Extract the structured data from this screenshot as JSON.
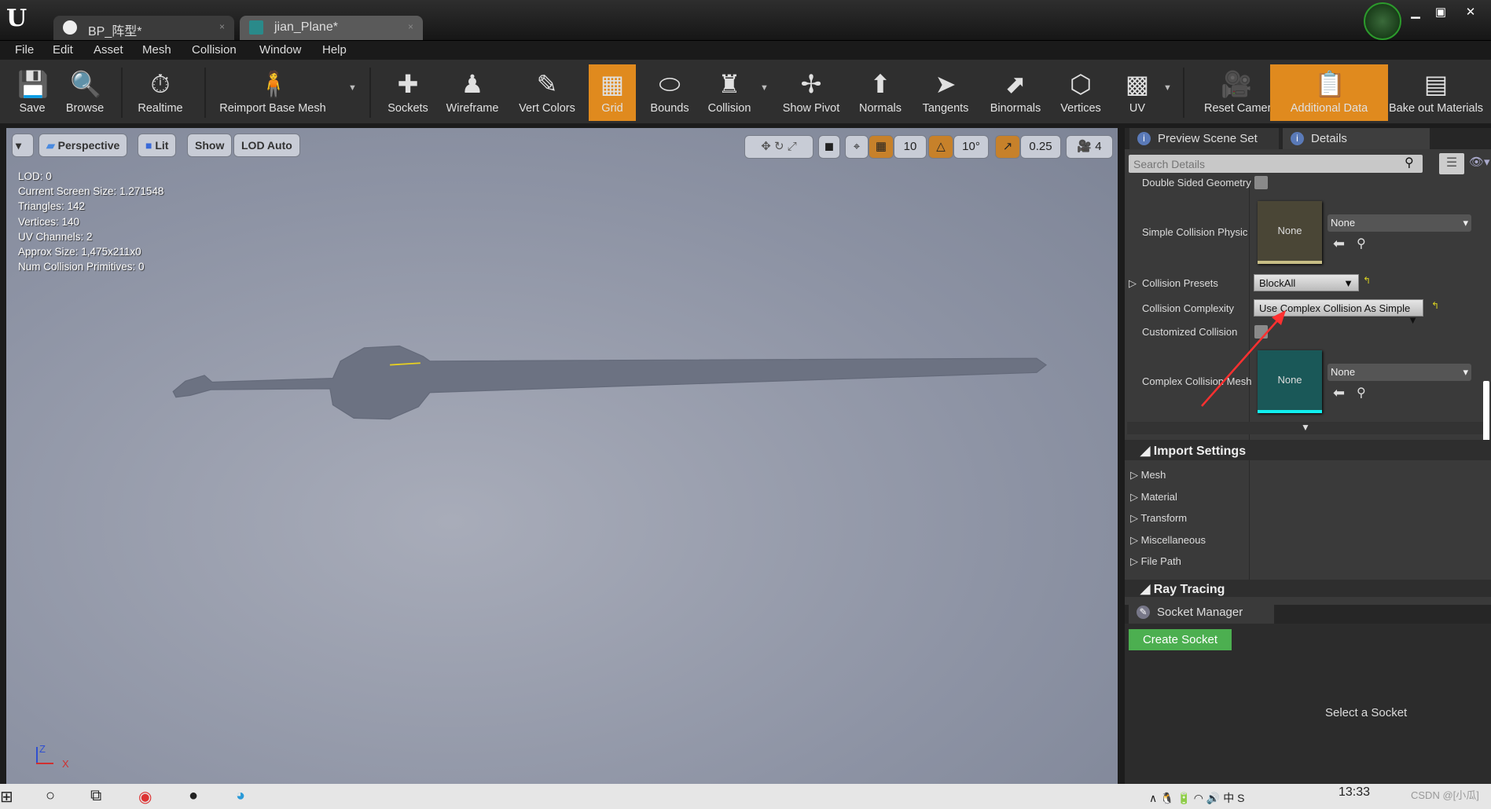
{
  "window": {
    "tabs": [
      {
        "label": "BP_阵型*"
      },
      {
        "label": "jian_Plane*"
      }
    ],
    "controls": [
      "minimize",
      "maximize",
      "close"
    ]
  },
  "menu": [
    "File",
    "Edit",
    "Asset",
    "Mesh",
    "Collision",
    "Window",
    "Help"
  ],
  "toolbar": [
    {
      "label": "Save",
      "icon": "💾"
    },
    {
      "label": "Browse",
      "icon": "🔍"
    },
    {
      "label": "Realtime",
      "icon": "⏱"
    },
    {
      "label": "Reimport Base Mesh",
      "icon": "🧍"
    },
    {
      "label": "Sockets",
      "icon": "✚"
    },
    {
      "label": "Wireframe",
      "icon": "♟"
    },
    {
      "label": "Vert Colors",
      "icon": "✎"
    },
    {
      "label": "Grid",
      "icon": "▦",
      "active": true
    },
    {
      "label": "Bounds",
      "icon": "⬭"
    },
    {
      "label": "Collision",
      "icon": "♜"
    },
    {
      "label": "Show Pivot",
      "icon": "✢"
    },
    {
      "label": "Normals",
      "icon": "⬆"
    },
    {
      "label": "Tangents",
      "icon": "➤"
    },
    {
      "label": "Binormals",
      "icon": "⬈"
    },
    {
      "label": "Vertices",
      "icon": "⬡"
    },
    {
      "label": "UV",
      "icon": "▩"
    },
    {
      "label": "Reset Camera",
      "icon": "🎥"
    },
    {
      "label": "Additional Data",
      "icon": "📋",
      "active": true
    },
    {
      "label": "Bake out Materials",
      "icon": "▤"
    }
  ],
  "viewport": {
    "buttons": {
      "perspective": "Perspective",
      "lit": "Lit",
      "show": "Show",
      "lod": "LOD Auto"
    },
    "stats": [
      "LOD:  0",
      "Current Screen Size:  1.271548",
      "Triangles:  142",
      "Vertices:  140",
      "UV Channels:  2",
      "Approx Size: 1,475x211x0",
      "Num Collision Primitives:  0"
    ],
    "grid_snap": "10",
    "rotation_snap": "10°",
    "scale_snap": "0.25",
    "camera_speed": "4",
    "axis": {
      "z": "Z",
      "x": "X"
    }
  },
  "panel": {
    "tabs": [
      "Preview Scene Set",
      "Details"
    ],
    "search_placeholder": "Search Details",
    "props": {
      "double_sided": "Double Sided Geometry",
      "simple_phys": "Simple Collision Physica",
      "simple_thumb": "None",
      "simple_value": "None",
      "presets": "Collision Presets",
      "presets_value": "BlockAll",
      "complexity": "Collision Complexity",
      "complexity_value": "Use Complex Collision As Simple",
      "customized": "Customized Collision",
      "complex_mesh": "Complex Collision Mesh",
      "complex_thumb": "None",
      "complex_value": "None"
    },
    "import_settings": "Import Settings",
    "import_items": [
      "Mesh",
      "Material",
      "Transform",
      "Miscellaneous",
      "File Path"
    ],
    "ray_tracing": "Ray Tracing",
    "socket_tab": "Socket Manager",
    "create_socket": "Create Socket",
    "select_socket": "Select a Socket"
  },
  "taskbar": {
    "time": "13:33",
    "watermark": "CSDN @[小瓜]"
  },
  "colors": {
    "accent": "#e08a1e",
    "create": "#4caf50",
    "annotation_arrow": "#ff3030"
  }
}
